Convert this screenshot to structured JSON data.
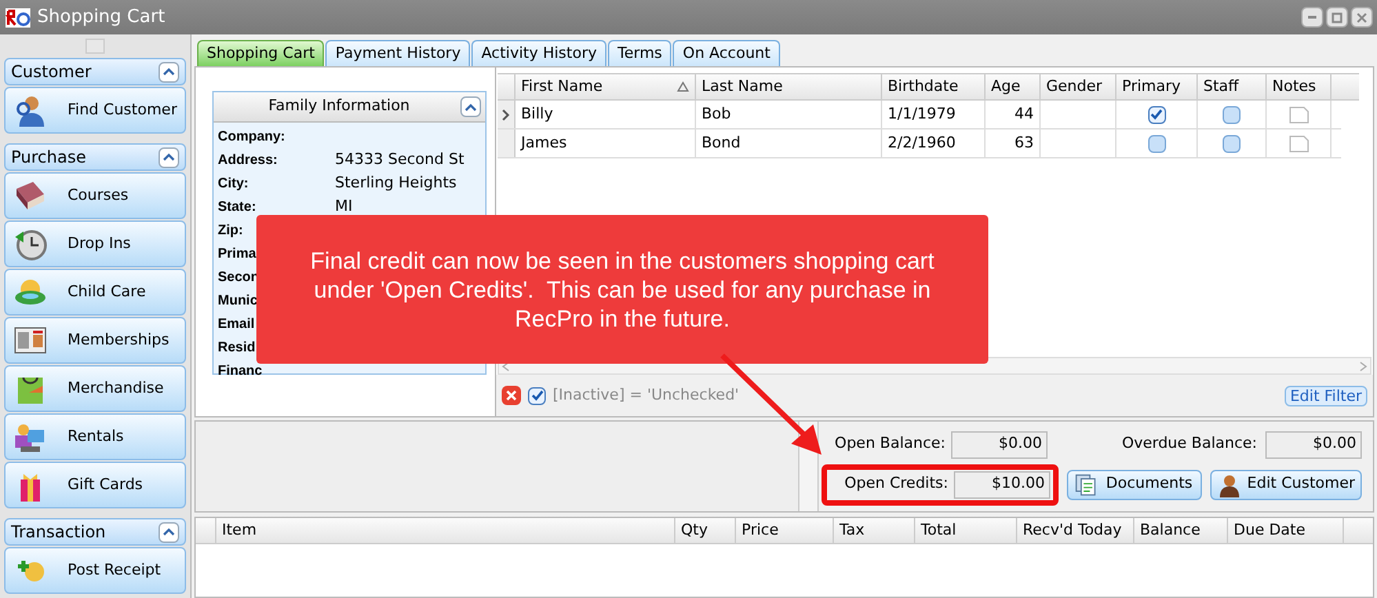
{
  "window": {
    "title": "Shopping Cart"
  },
  "sidebar": {
    "sections": [
      {
        "title": "Customer",
        "expanded": true,
        "items": [
          {
            "label": "Find Customer"
          }
        ]
      },
      {
        "title": "Purchase",
        "expanded": true,
        "items": [
          {
            "label": "Courses"
          },
          {
            "label": "Drop Ins"
          },
          {
            "label": "Child Care"
          },
          {
            "label": "Memberships"
          },
          {
            "label": "Merchandise"
          },
          {
            "label": "Rentals"
          },
          {
            "label": "Gift Cards"
          }
        ]
      },
      {
        "title": "Transaction",
        "expanded": true,
        "items": [
          {
            "label": "Post Receipt"
          }
        ]
      }
    ]
  },
  "tabs": [
    {
      "label": "Shopping Cart",
      "selected": true
    },
    {
      "label": "Payment History",
      "selected": false
    },
    {
      "label": "Activity History",
      "selected": false
    },
    {
      "label": "Terms",
      "selected": false
    },
    {
      "label": "On Account",
      "selected": false
    }
  ],
  "family_info": {
    "title": "Family Information",
    "fields": [
      {
        "label": "Company:"
      },
      {
        "label": "Address:",
        "value": "54333 Second St"
      },
      {
        "label": "City:",
        "value": "Sterling Heights"
      },
      {
        "label": "State:",
        "value": "MI"
      },
      {
        "label": "Zip:"
      },
      {
        "label": "Prima"
      },
      {
        "label": "Secon"
      },
      {
        "label": "Munic"
      },
      {
        "label": "Email"
      },
      {
        "label": "Resid"
      },
      {
        "label": "Financ"
      }
    ]
  },
  "members": {
    "columns": [
      {
        "label": "First Name",
        "sorted": true
      },
      {
        "label": "Last Name",
        "sorted": false
      },
      {
        "label": "Birthdate",
        "sorted": false
      },
      {
        "label": "Age",
        "sorted": false
      },
      {
        "label": "Gender",
        "sorted": false
      },
      {
        "label": "Primary",
        "sorted": false
      },
      {
        "label": "Staff",
        "sorted": false
      },
      {
        "label": "Notes",
        "sorted": false
      }
    ],
    "rows": [
      {
        "current": true,
        "first_name": "Billy",
        "last_name": "Bob",
        "birthdate": "1/1/1979",
        "age": "44",
        "primary": true,
        "staff": false
      },
      {
        "current": false,
        "first_name": "James",
        "last_name": "Bond",
        "birthdate": "2/2/1960",
        "age": "63",
        "primary": false,
        "staff": false
      }
    ]
  },
  "filter": {
    "enabled": true,
    "text": "[Inactive] = 'Unchecked'",
    "button": "Edit Filter"
  },
  "balances": {
    "open_balance_label": "Open Balance:",
    "open_balance": "$0.00",
    "overdue_label": "Overdue Balance:",
    "overdue": "$0.00",
    "open_credits_label": "Open Credits:",
    "open_credits": "$10.00",
    "buttons": [
      "Documents",
      "Edit Customer"
    ]
  },
  "cart": {
    "columns": [
      "Item",
      "Qty",
      "Price",
      "Tax",
      "Total",
      "Recv'd Today",
      "Balance",
      "Due Date"
    ]
  },
  "callout": {
    "text": "Final credit can now be seen in the customers shopping cart under 'Open Credits'.  This can be used for any purchase in RecPro in the future."
  }
}
